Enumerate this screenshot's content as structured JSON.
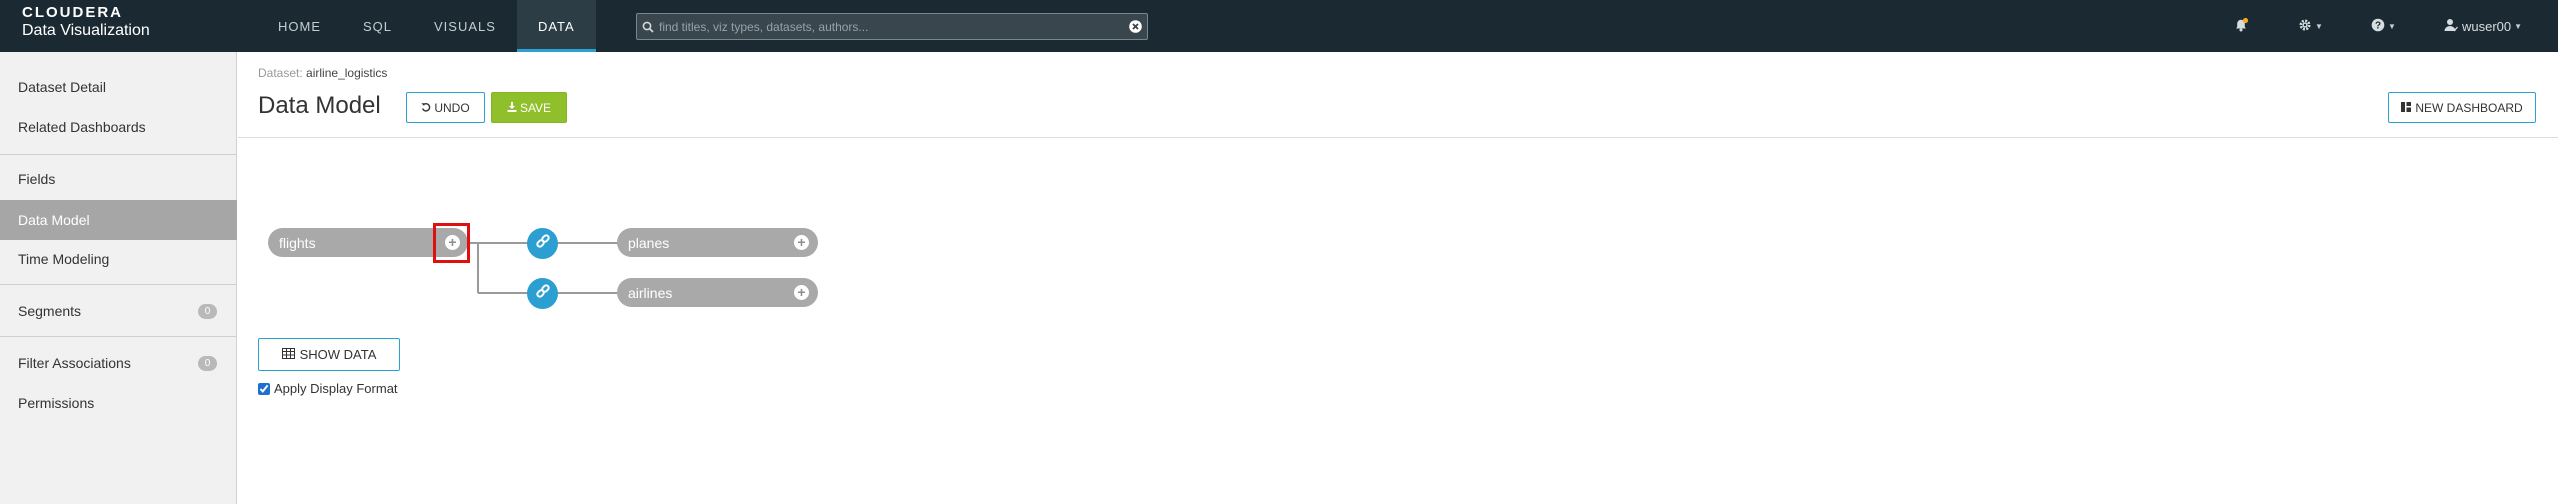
{
  "brand": {
    "line1": "CLOUDERA",
    "line2": "Data Visualization"
  },
  "nav": [
    {
      "label": "HOME"
    },
    {
      "label": "SQL"
    },
    {
      "label": "VISUALS"
    },
    {
      "label": "DATA",
      "active": true
    }
  ],
  "search": {
    "placeholder": "find titles, viz types, datasets, authors..."
  },
  "user": {
    "name": "wuser00"
  },
  "sidebar": {
    "items": [
      {
        "label": "Dataset Detail"
      },
      {
        "label": "Related Dashboards"
      },
      {
        "label": "Fields"
      },
      {
        "label": "Data Model",
        "active": true
      },
      {
        "label": "Time Modeling"
      },
      {
        "label": "Segments",
        "badge": "0"
      },
      {
        "label": "Filter Associations",
        "badge": "0"
      },
      {
        "label": "Permissions"
      }
    ]
  },
  "breadcrumb": {
    "prefix": "Dataset:",
    "value": "airline_logistics"
  },
  "page_title": "Data Model",
  "buttons": {
    "undo": "UNDO",
    "save": "SAVE",
    "new_dashboard": "NEW DASHBOARD",
    "show_data": "SHOW DATA"
  },
  "graph": {
    "root": "flights",
    "joins": [
      "planes",
      "airlines"
    ]
  },
  "apply_display_format": {
    "label": "Apply Display Format",
    "checked": true
  },
  "colors": {
    "topbar": "#1b2a32",
    "accent": "#2ba1d3",
    "save": "#8fbf2a",
    "node": "#a9a9a9",
    "highlight": "#e01010"
  }
}
